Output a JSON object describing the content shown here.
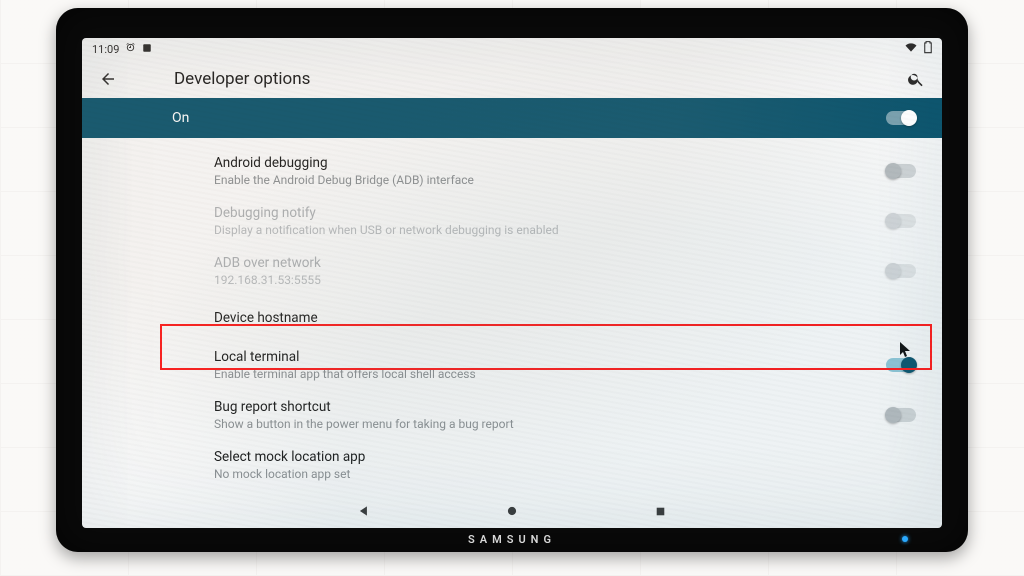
{
  "monitor": {
    "brand": "SAMSUNG"
  },
  "status_bar": {
    "time": "11:09",
    "icons_left": [
      "alarm",
      "app-badge"
    ],
    "icons_right": [
      "wifi",
      "battery"
    ]
  },
  "appbar": {
    "title": "Developer options"
  },
  "master": {
    "label": "On",
    "enabled": true
  },
  "items": [
    {
      "key": "android_debugging",
      "title": "Android debugging",
      "subtitle": "Enable the Android Debug Bridge (ADB) interface",
      "disabled": false,
      "toggle": {
        "present": true,
        "on": false
      }
    },
    {
      "key": "debugging_notify",
      "title": "Debugging notify",
      "subtitle": "Display a notification when USB or network debugging is enabled",
      "disabled": true,
      "toggle": {
        "present": true,
        "on": false
      }
    },
    {
      "key": "adb_over_network",
      "title": "ADB over network",
      "subtitle": "192.168.31.53:5555",
      "disabled": true,
      "toggle": {
        "present": true,
        "on": false
      }
    },
    {
      "key": "device_hostname",
      "title": "Device hostname",
      "subtitle": "",
      "disabled": false,
      "toggle": {
        "present": false
      }
    },
    {
      "key": "local_terminal",
      "title": "Local terminal",
      "subtitle": "Enable terminal app that offers local shell access",
      "disabled": false,
      "toggle": {
        "present": true,
        "on": true
      },
      "highlighted": true
    },
    {
      "key": "bug_report_shortcut",
      "title": "Bug report shortcut",
      "subtitle": "Show a button in the power menu for taking a bug report",
      "disabled": false,
      "toggle": {
        "present": true,
        "on": false
      }
    },
    {
      "key": "select_mock_location",
      "title": "Select mock location app",
      "subtitle": "No mock location app set",
      "disabled": false,
      "toggle": {
        "present": false
      }
    }
  ]
}
